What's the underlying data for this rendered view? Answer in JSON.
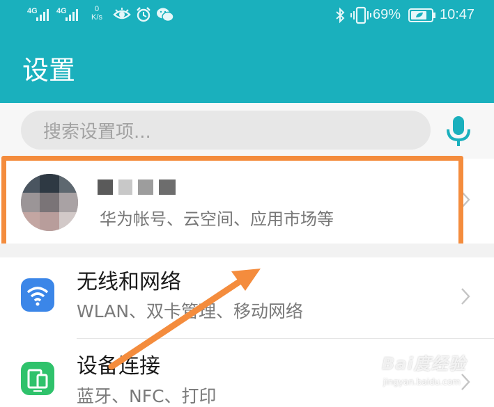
{
  "status_bar": {
    "network_1": "4G",
    "network_2": "4G",
    "speed_value": "0",
    "speed_unit": "K/s",
    "battery_percent": "69%",
    "time": "10:47",
    "icons": [
      "signal-icon",
      "eye-icon",
      "alarm-icon",
      "wechat-icon",
      "bluetooth-icon",
      "vibrate-icon",
      "battery-icon"
    ]
  },
  "header": {
    "title": "设置"
  },
  "search": {
    "placeholder": "搜索设置项...",
    "voice_icon": "microphone-icon"
  },
  "account": {
    "subtitle": "华为帐号、云空间、应用市场等",
    "highlight_color": "#f48c3d"
  },
  "settings_items": [
    {
      "title": "无线和网络",
      "subtitle": "WLAN、双卡管理、移动网络",
      "icon": "wifi-icon",
      "icon_color": "#3b86e8"
    },
    {
      "title": "设备连接",
      "subtitle": "蓝牙、NFC、打印",
      "icon": "device-connection-icon",
      "icon_color": "#2fc26b"
    }
  ],
  "watermark": {
    "main": "Bai度经验",
    "sub": "jingyan.baidu.com"
  },
  "colors": {
    "accent": "#1ab0bd",
    "mic": "#1ab0bd",
    "annotation": "#f48c3d"
  }
}
